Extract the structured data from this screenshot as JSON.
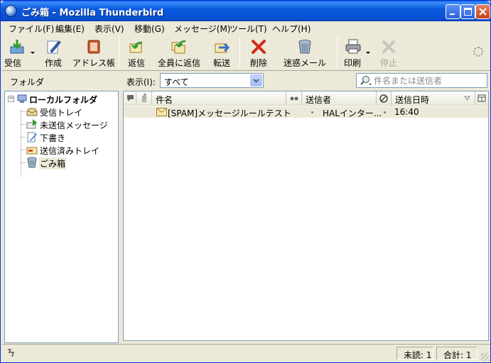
{
  "window": {
    "title": "ごみ箱 - Mozilla Thunderbird"
  },
  "menu": [
    "ファイル(F)",
    "編集(E)",
    "表示(V)",
    "移動(G)",
    "メッセージ(M)",
    "ツール(T)",
    "ヘルプ(H)"
  ],
  "toolbar": {
    "get_mail": "受信",
    "compose": "作成",
    "address_book": "アドレス帳",
    "reply": "返信",
    "reply_all": "全員に返信",
    "forward": "転送",
    "delete": "削除",
    "junk": "迷惑メール",
    "print": "印刷",
    "stop": "停止"
  },
  "folder_pane": {
    "header": "フォルダ",
    "root": "ローカルフォルダ",
    "folders": [
      "受信トレイ",
      "未送信メッセージ",
      "下書き",
      "送信済みトレイ",
      "ごみ箱"
    ],
    "selected": "ごみ箱"
  },
  "viewbar": {
    "label": "表示(I):",
    "selected": "すべて",
    "search_placeholder": "件名または送信者"
  },
  "columns": {
    "subject": "件名",
    "sender": "送信者",
    "date": "送信日時"
  },
  "messages": [
    {
      "subject": "[SPAM]メッセージルールテスト",
      "sender": "HALインター...",
      "date": "16:40"
    }
  ],
  "status": {
    "unread": "未読: 1",
    "total": "合計: 1"
  },
  "colors": {
    "titlebar": "#0A4FD0",
    "chrome": "#ECE9D8",
    "border": "#7F9DB9",
    "selection_row": "#ECE9D8"
  }
}
